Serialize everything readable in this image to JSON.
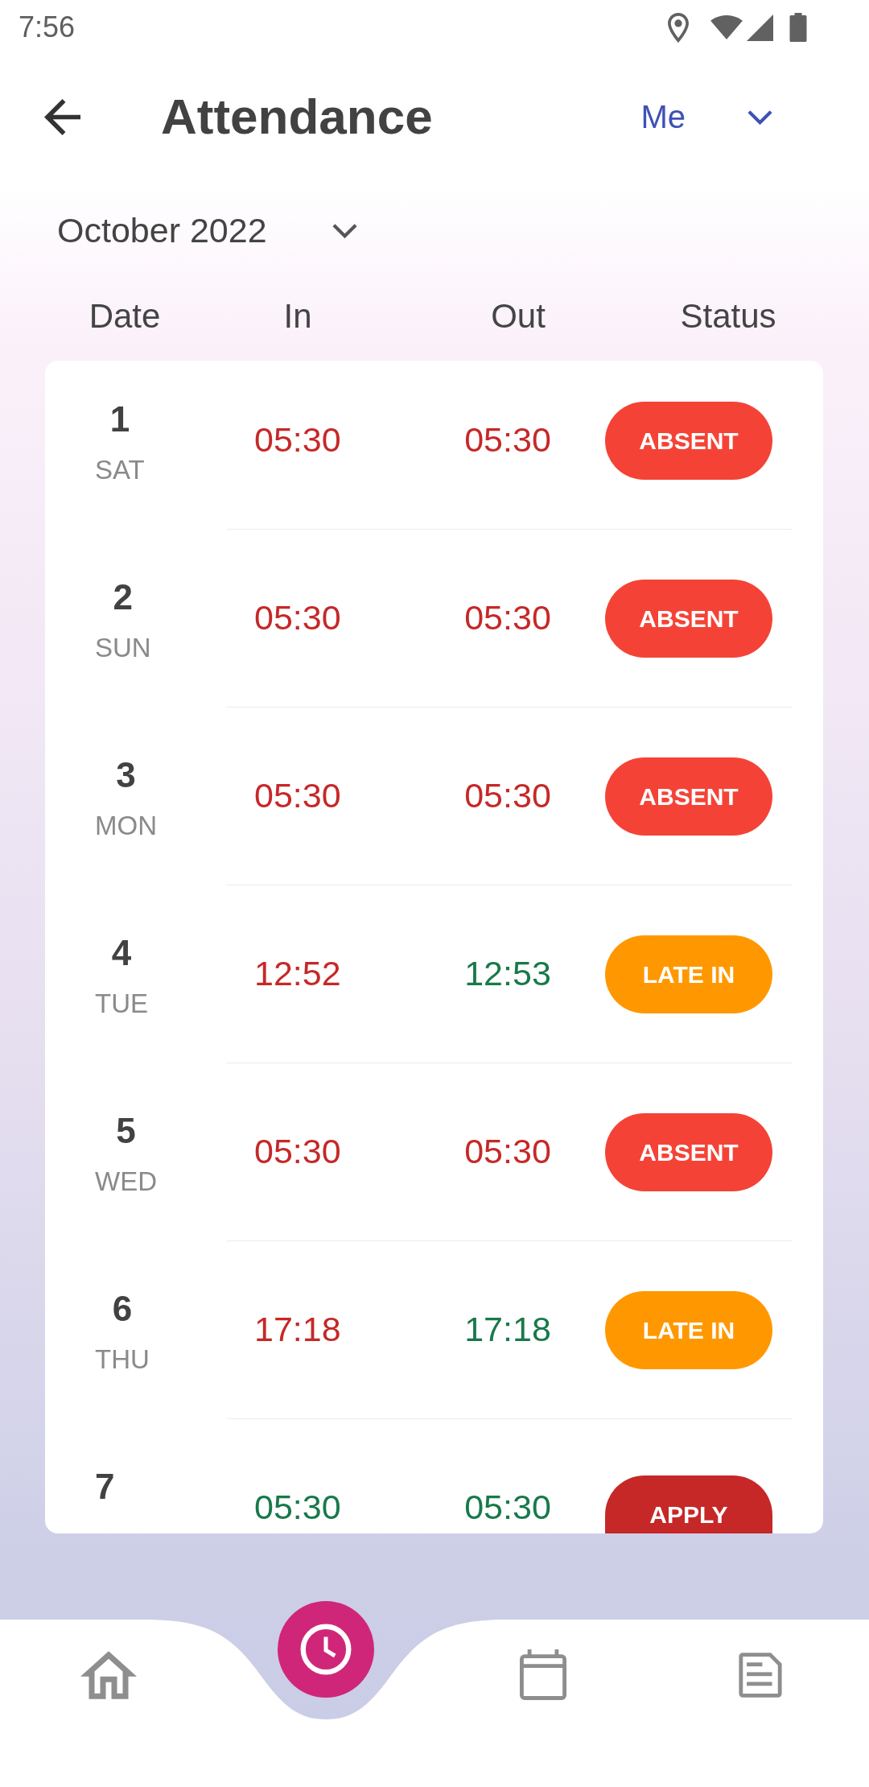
{
  "status_bar": {
    "time": "7:56"
  },
  "header": {
    "title": "Attendance",
    "employee_filter": "Me"
  },
  "month_picker": {
    "value": "October 2022"
  },
  "table": {
    "columns": [
      "Date",
      "In",
      "Out",
      "Status"
    ],
    "rows": [
      {
        "day": "1",
        "weekday": "SAT",
        "in": {
          "time": "05:30",
          "color": "#c62828"
        },
        "out": {
          "time": "05:30",
          "color": "#c62828"
        },
        "status": {
          "label": "ABSENT",
          "color": "#f44336"
        }
      },
      {
        "day": "2",
        "weekday": "SUN",
        "in": {
          "time": "05:30",
          "color": "#c62828"
        },
        "out": {
          "time": "05:30",
          "color": "#c62828"
        },
        "status": {
          "label": "ABSENT",
          "color": "#f44336"
        }
      },
      {
        "day": "3",
        "weekday": "MON",
        "in": {
          "time": "05:30",
          "color": "#c62828"
        },
        "out": {
          "time": "05:30",
          "color": "#c62828"
        },
        "status": {
          "label": "ABSENT",
          "color": "#f44336"
        }
      },
      {
        "day": "4",
        "weekday": "TUE",
        "in": {
          "time": "12:52",
          "color": "#c62828"
        },
        "out": {
          "time": "12:53",
          "color": "#18794a"
        },
        "status": {
          "label": "LATE IN",
          "color": "#ff9800"
        }
      },
      {
        "day": "5",
        "weekday": "WED",
        "in": {
          "time": "05:30",
          "color": "#c62828"
        },
        "out": {
          "time": "05:30",
          "color": "#c62828"
        },
        "status": {
          "label": "ABSENT",
          "color": "#f44336"
        }
      },
      {
        "day": "6",
        "weekday": "THU",
        "in": {
          "time": "17:18",
          "color": "#c62828"
        },
        "out": {
          "time": "17:18",
          "color": "#18794a"
        },
        "status": {
          "label": "LATE IN",
          "color": "#ff9800"
        }
      },
      {
        "day": "7",
        "in": {
          "time": "05:30",
          "color": "#18794a"
        },
        "out": {
          "time": "05:30",
          "color": "#18794a"
        },
        "status": {
          "label": "APPLY",
          "color": "#c62828"
        }
      }
    ]
  },
  "bottom_nav": [
    {
      "kind": "home",
      "selected": false
    },
    {
      "kind": "clock",
      "selected": true
    },
    {
      "kind": "calendar",
      "selected": false
    },
    {
      "kind": "notes",
      "selected": false
    }
  ]
}
